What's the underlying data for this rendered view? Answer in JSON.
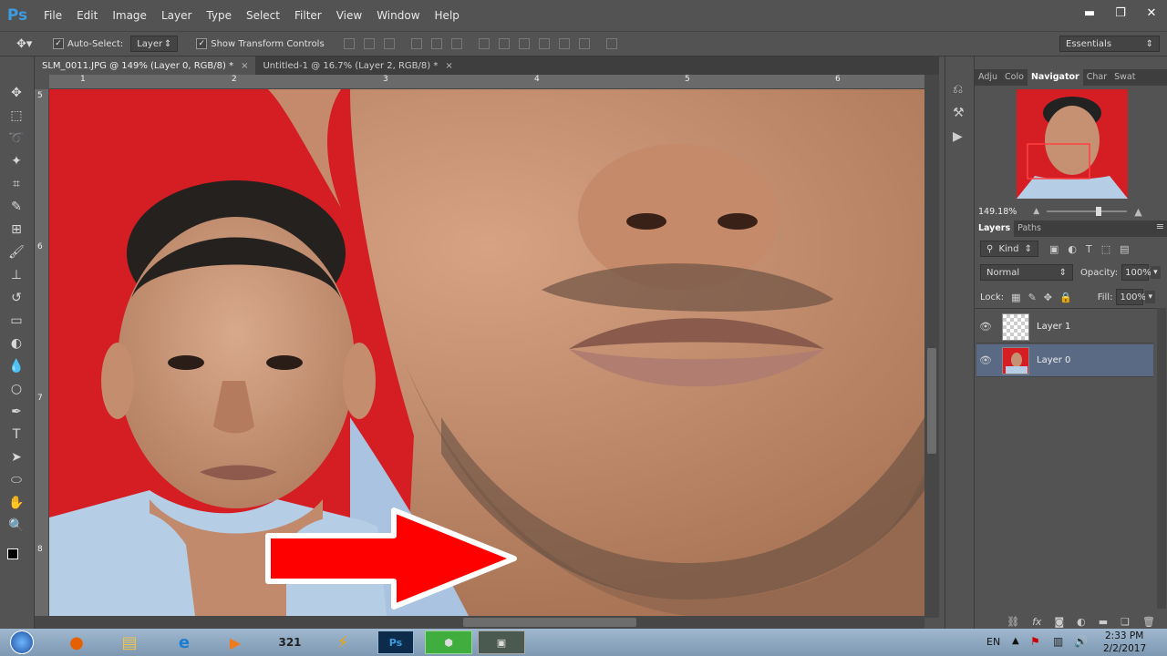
{
  "app": {
    "logo": "Ps",
    "menu": [
      "File",
      "Edit",
      "Image",
      "Layer",
      "Type",
      "Select",
      "Filter",
      "View",
      "Window",
      "Help"
    ],
    "window_controls": [
      "▬",
      "❐",
      "✕"
    ]
  },
  "options_bar": {
    "auto_select_label": "Auto-Select:",
    "auto_select_value": "Layer",
    "show_transform_label": "Show Transform Controls",
    "workspace": "Essentials"
  },
  "tabs": [
    {
      "label": "SLM_0011.JPG @ 149% (Layer 0, RGB/8) *",
      "close": "×"
    },
    {
      "label": "Untitled-1 @ 16.7% (Layer 2, RGB/8) *",
      "close": "×"
    }
  ],
  "ruler": {
    "h": [
      "1",
      "2",
      "3",
      "4",
      "5",
      "6"
    ],
    "v": [
      "5",
      "6",
      "7",
      "8"
    ]
  },
  "panels": {
    "top_tabs": [
      "Adju",
      "Colo",
      "Navigator",
      "Char",
      "Swat"
    ],
    "zoom": "149.18%",
    "layers_tabs": [
      "Layers",
      "Paths"
    ],
    "kind": "Kind",
    "blend_mode": "Normal",
    "opacity_label": "Opacity:",
    "opacity_value": "100%",
    "lock_label": "Lock:",
    "fill_label": "Fill:",
    "fill_value": "100%",
    "layers": [
      {
        "name": "Layer 1",
        "selected": false
      },
      {
        "name": "Layer 0",
        "selected": true
      }
    ],
    "bottom_icons": [
      "link-icon",
      "fx-icon",
      "mask-icon",
      "adjustment-icon",
      "folder-icon",
      "new-layer-icon",
      "trash-icon"
    ]
  },
  "taskbar": {
    "lang": "EN",
    "time": "2:33 PM",
    "date": "2/2/2017"
  },
  "colors": {
    "accent": "#ff0000",
    "selected_layer": "#5a6a85",
    "background_red": "#d41e24"
  }
}
